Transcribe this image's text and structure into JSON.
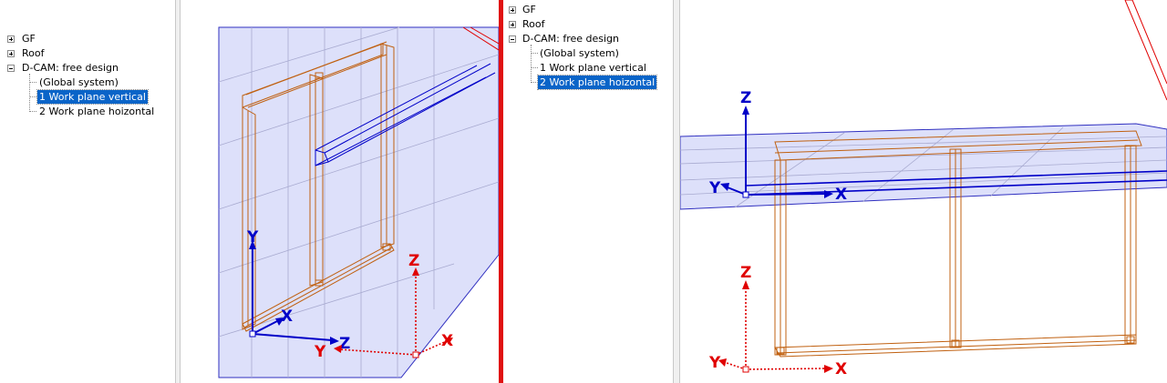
{
  "left_panel": {
    "tree": [
      {
        "label": "GF",
        "expander": "plus"
      },
      {
        "label": "Roof",
        "expander": "plus"
      },
      {
        "label": "D-CAM: free design",
        "expander": "minus"
      },
      {
        "label": "(Global system)"
      },
      {
        "label": "1 Work plane vertical",
        "selected": true
      },
      {
        "label": "2 Work plane hoizontal"
      }
    ],
    "axes": {
      "local_y": "Y",
      "local_x": "X",
      "local_z": "Z",
      "global_z": "Z",
      "global_y": "Y",
      "global_x": "X"
    }
  },
  "right_panel": {
    "tree": [
      {
        "label": "GF",
        "expander": "plus"
      },
      {
        "label": "Roof",
        "expander": "plus"
      },
      {
        "label": "D-CAM: free design",
        "expander": "minus"
      },
      {
        "label": "(Global system)"
      },
      {
        "label": "1 Work plane vertical"
      },
      {
        "label": "2 Work plane hoizontal",
        "selected": true
      }
    ],
    "axes": {
      "local_z": "Z",
      "local_y": "Y",
      "local_x": "X",
      "global_z": "Z",
      "global_y": "Y",
      "global_x": "X"
    }
  },
  "colors": {
    "local_axis": "#0000c8",
    "global_axis": "#e00000",
    "frame": "#c06010",
    "plane": "#dde0fa",
    "divider": "#e01010",
    "selection": "#0a64c8"
  }
}
